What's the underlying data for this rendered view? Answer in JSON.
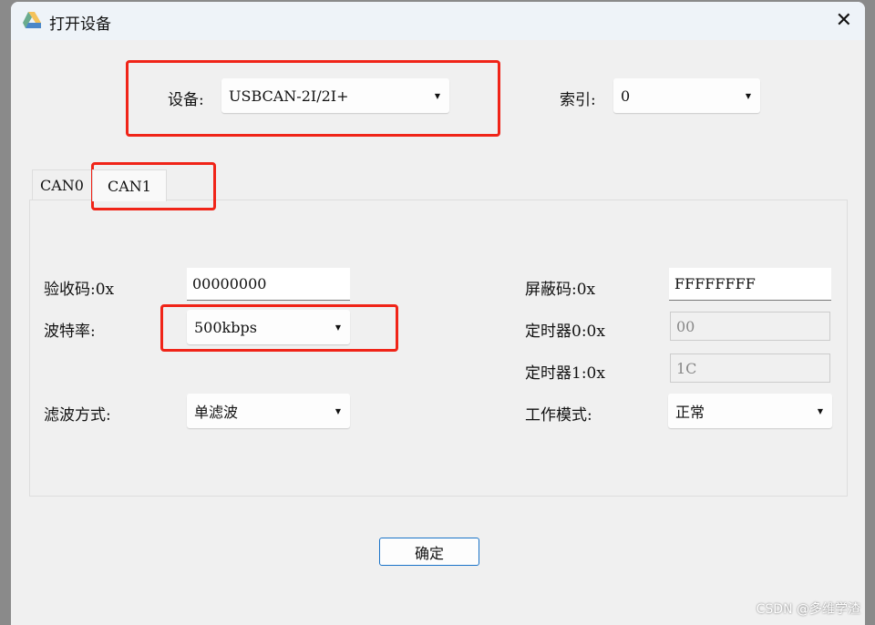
{
  "window": {
    "title": "打开设备"
  },
  "device": {
    "label": "设备:",
    "value": "USBCAN-2I/2I+"
  },
  "index": {
    "label": "索引:",
    "value": "0"
  },
  "tabs": [
    {
      "label": "CAN0"
    },
    {
      "label": "CAN1",
      "active": true
    }
  ],
  "form": {
    "acc_code": {
      "label": "验收码:0x",
      "value": "00000000"
    },
    "baud": {
      "label": "波特率:",
      "value": "500kbps"
    },
    "filter": {
      "label": "滤波方式:",
      "value": "单滤波"
    },
    "mask": {
      "label": "屏蔽码:0x",
      "value": "FFFFFFFF"
    },
    "timer0": {
      "label": "定时器0:0x",
      "value": "00"
    },
    "timer1": {
      "label": "定时器1:0x",
      "value": "1C"
    },
    "mode": {
      "label": "工作模式:",
      "value": "正常"
    }
  },
  "ok_label": "确定",
  "watermark": "CSDN @多维学渣",
  "colors": {
    "annotation": "#f02418",
    "accent": "#1a73c8"
  }
}
